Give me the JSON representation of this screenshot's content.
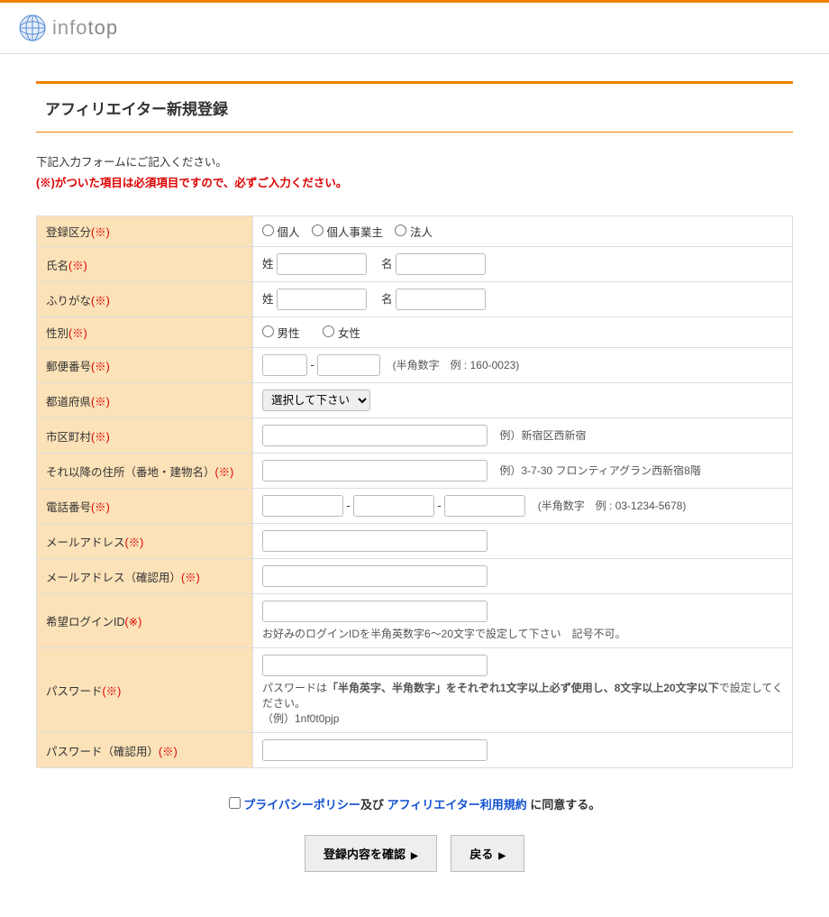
{
  "logo": {
    "text_a": "info",
    "text_b": "top"
  },
  "title": "アフィリエイター新規登録",
  "intro": "下記入力フォームにご記入ください。",
  "intro_required": "(※)がついた項目は必須項目ですので、必ずご入力ください。",
  "required_mark": "(※)",
  "fields": {
    "category": {
      "label": "登録区分",
      "opt1": "個人",
      "opt2": "個人事業主",
      "opt3": "法人"
    },
    "name": {
      "label": "氏名",
      "sei": "姓",
      "mei": "名"
    },
    "furigana": {
      "label": "ふりがな",
      "sei": "姓",
      "mei": "名"
    },
    "gender": {
      "label": "性別",
      "opt1": "男性",
      "opt2": "女性"
    },
    "postal": {
      "label": "郵便番号",
      "hint": "(半角数字　例 : 160-0023)"
    },
    "pref": {
      "label": "都道府県",
      "placeholder": "選択して下さい"
    },
    "city": {
      "label": "市区町村",
      "hint": "例）新宿区西新宿"
    },
    "address": {
      "label": "それ以降の住所（番地・建物名）",
      "hint": "例）3-7-30 フロンティアグラン西新宿8階"
    },
    "phone": {
      "label": "電話番号",
      "hint": "(半角数字　例 : 03-1234-5678)"
    },
    "email": {
      "label": "メールアドレス"
    },
    "email2": {
      "label": "メールアドレス（確認用）"
    },
    "login": {
      "label": "希望ログインID",
      "hint": "お好みのログインIDを半角英数字6〜20文字で設定して下さい　記号不可。"
    },
    "password": {
      "label": "パスワード",
      "hint_a": "パスワードは",
      "hint_b": "「半角英字、半角数字」をそれぞれ1文字以上必ず使用し、8文字以上20文字以下",
      "hint_c": "で設定してください。",
      "hint_d": "（例）1nf0t0pjp"
    },
    "password2": {
      "label": "パスワード（確認用）"
    }
  },
  "agreement": {
    "link1": "プライバシーポリシー",
    "mid": "及び",
    "link2": "アフィリエイター利用規約",
    "tail": " に同意する。"
  },
  "buttons": {
    "confirm": "登録内容を確認",
    "back": "戻る"
  }
}
